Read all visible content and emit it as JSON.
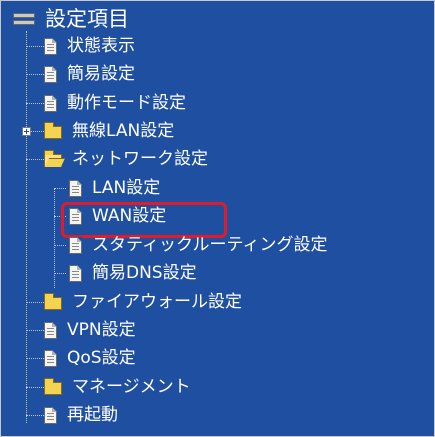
{
  "tree": {
    "root_label": "設定項目",
    "items": [
      {
        "label": "状態表示",
        "icon": "document-icon"
      },
      {
        "label": "簡易設定",
        "icon": "document-icon"
      },
      {
        "label": "動作モード設定",
        "icon": "document-icon"
      },
      {
        "label": "無線LAN設定",
        "icon": "folder-icon",
        "expander": "plus"
      },
      {
        "label": "ネットワーク設定",
        "icon": "open-folder-icon"
      },
      {
        "label": "LAN設定",
        "icon": "document-icon"
      },
      {
        "label": "WAN設定",
        "icon": "document-icon",
        "highlighted": true,
        "highlight_color": "#e21b2b"
      },
      {
        "label": "スタティックルーティング設定",
        "icon": "document-icon"
      },
      {
        "label": "簡易DNS設定",
        "icon": "document-icon"
      },
      {
        "label": "ファイアウォール設定",
        "icon": "folder-icon"
      },
      {
        "label": "VPN設定",
        "icon": "document-icon"
      },
      {
        "label": "QoS設定",
        "icon": "document-icon"
      },
      {
        "label": "マネージメント",
        "icon": "folder-icon"
      },
      {
        "label": "再起動",
        "icon": "document-icon"
      }
    ]
  },
  "colors": {
    "background": "#1f4fa0",
    "text": "#ffffff",
    "highlight": "#e21b2b"
  }
}
